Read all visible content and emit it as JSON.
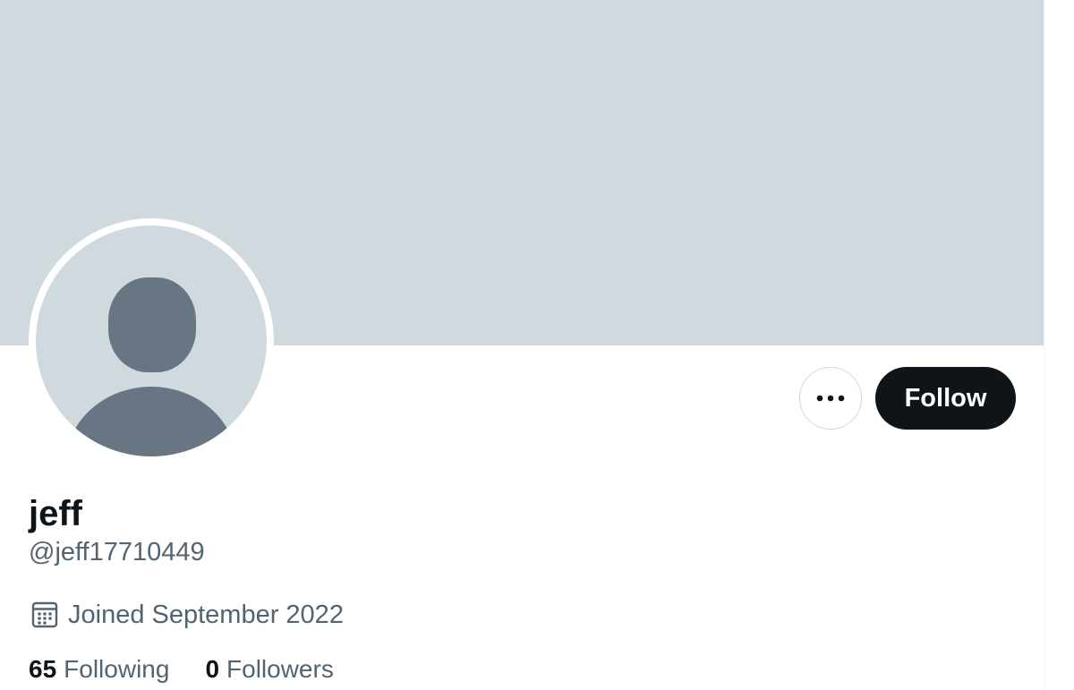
{
  "profile": {
    "display_name": "jeff",
    "handle": "@jeff17710449",
    "joined": "Joined September 2022",
    "following_count": "65",
    "following_label": "Following",
    "followers_count": "0",
    "followers_label": "Followers"
  },
  "actions": {
    "more_icon": "more-horizontal-icon",
    "follow_label": "Follow"
  },
  "icons": {
    "joined": "calendar-icon",
    "avatar": "default-avatar-icon"
  },
  "colors": {
    "banner": "#cfd9de",
    "avatar_bg": "#cfd9de",
    "avatar_silhouette": "#687684",
    "follow_bg": "#0f1419",
    "secondary_text": "#536471",
    "primary_text": "#0f1419"
  }
}
